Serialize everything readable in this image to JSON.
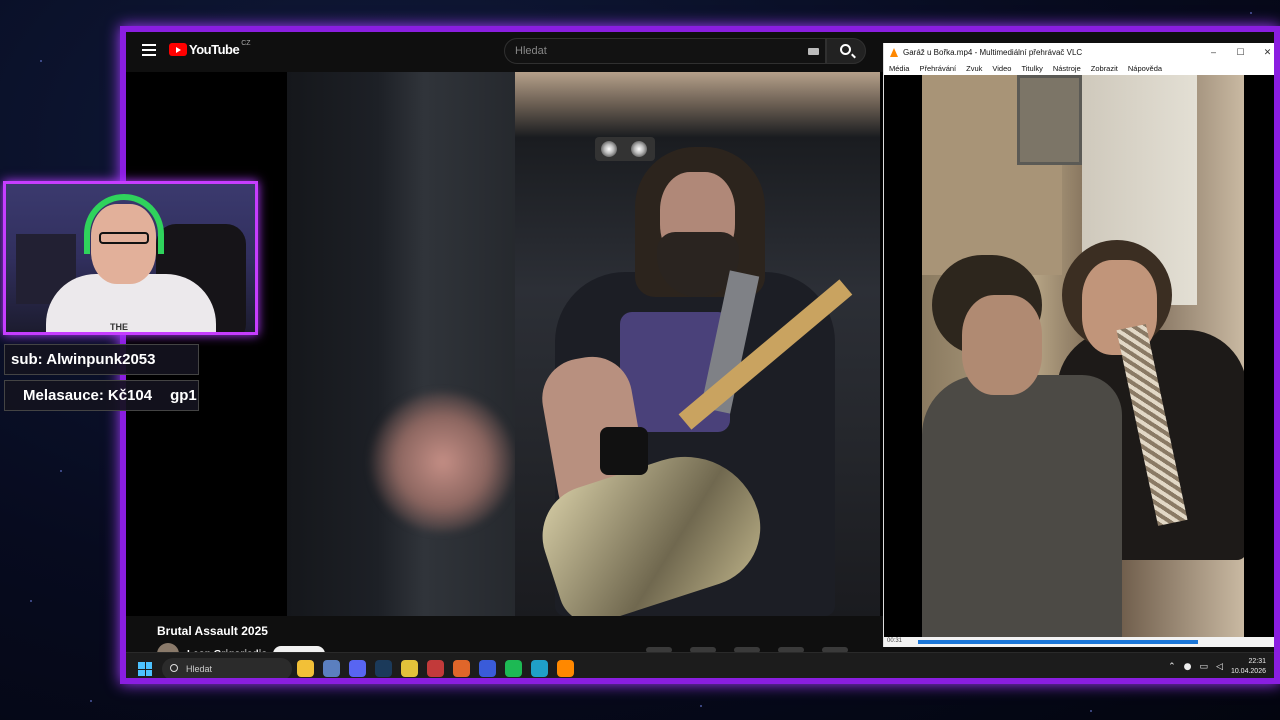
{
  "youtube": {
    "logo_text": "YouTube",
    "region": "CZ",
    "search_placeholder": "Hledat",
    "video_title": "Brutal Assault 2025",
    "channel_name": "Leon Grigoriadis"
  },
  "vlc": {
    "window_title": "Garáž u Bořka.mp4 - Multimediální přehrávač VLC",
    "menu": [
      "Média",
      "Přehrávání",
      "Zvuk",
      "Video",
      "Titulky",
      "Nástroje",
      "Zobrazit",
      "Nápověda"
    ],
    "time_elapsed": "00:31",
    "window_controls": [
      "–",
      "☐",
      "✕"
    ]
  },
  "taskbar": {
    "search_placeholder": "Hledat",
    "apps": [
      {
        "name": "file-explorer",
        "color": "#f2c037"
      },
      {
        "name": "calculator",
        "color": "#5b7fbf"
      },
      {
        "name": "discord",
        "color": "#5865f2"
      },
      {
        "name": "steam",
        "color": "#1b3a5a"
      },
      {
        "name": "chrome",
        "color": "#e2c23a"
      },
      {
        "name": "app",
        "color": "#c23a3a"
      },
      {
        "name": "firefox",
        "color": "#e0662a"
      },
      {
        "name": "vivaldi",
        "color": "#3a5bd9"
      },
      {
        "name": "spotify",
        "color": "#1db954"
      },
      {
        "name": "edge",
        "color": "#1fa0c8"
      },
      {
        "name": "vlc",
        "color": "#ff8800"
      }
    ],
    "time": "22:31",
    "date": "10.04.2026"
  },
  "overlay": {
    "sub_text": "sub: Alwinpunk2053",
    "donor": "Melasauce:",
    "amount": "Kč104",
    "tag": "gp1",
    "shirt_text": "THE"
  },
  "colors": {
    "frame": "#8a1ee0",
    "webcam_border": "#c63dff",
    "youtube_red": "#ff0000",
    "vlc_orange": "#ff8800",
    "seek_blue": "#1c77d8"
  }
}
